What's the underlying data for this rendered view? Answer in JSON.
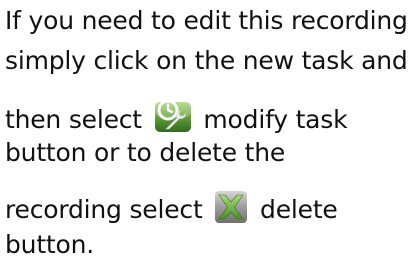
{
  "instructions": {
    "line1": "If you need to edit this recording",
    "line2": "simply click on the new task and",
    "line3_before": "then select",
    "line3_after": "modify task",
    "line4": "button or to delete the",
    "line5_before": "recording select",
    "line5_after": "delete",
    "line6": "button."
  },
  "icons": {
    "modify": "modify-task-icon",
    "delete": "delete-icon"
  },
  "colors": {
    "text": "#111111",
    "icon_green": "#4f8a2e",
    "icon_gray": "#9a9a9a"
  }
}
